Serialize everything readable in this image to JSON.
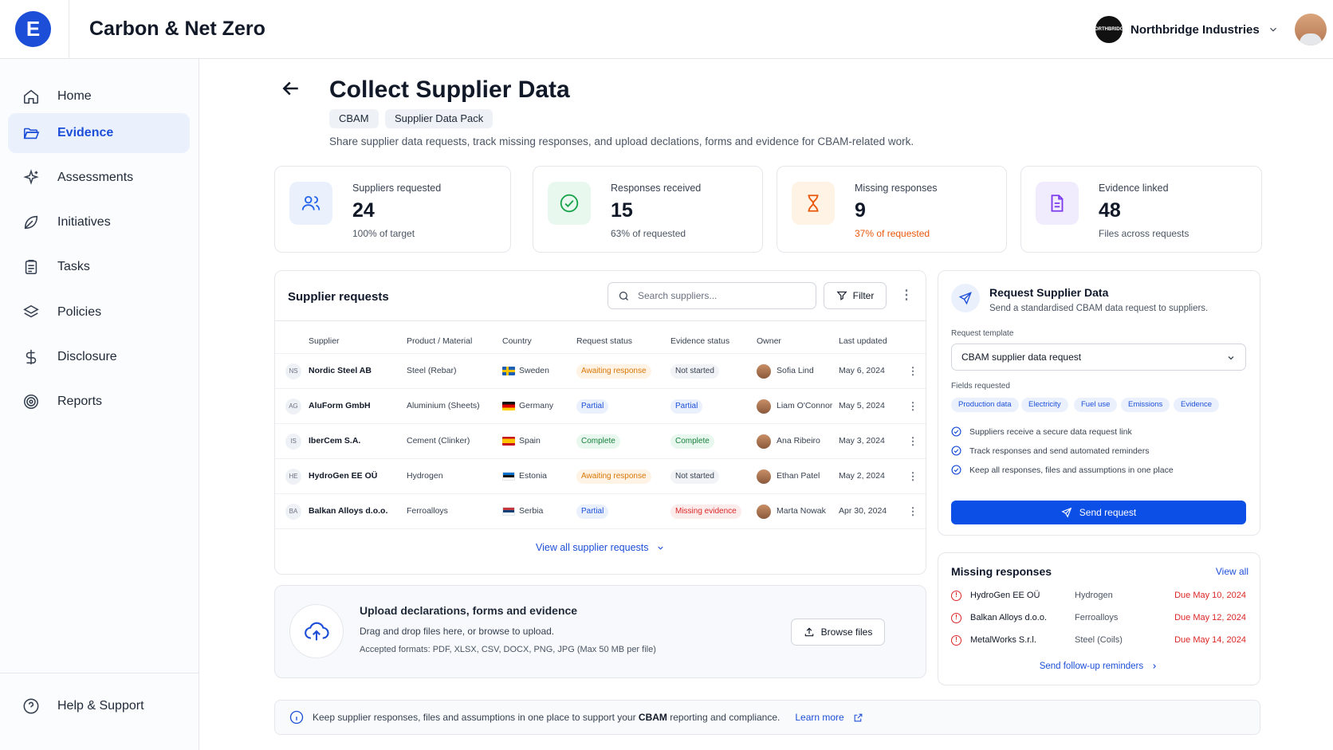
{
  "app": {
    "logo_letter": "E",
    "title": "Carbon & Net Zero",
    "org_name": "Northbridge Industries",
    "org_logo_text": "NORTHBRIDGE"
  },
  "nav": {
    "items": [
      {
        "label": "Home"
      },
      {
        "label": "Evidence"
      },
      {
        "label": "Assessments"
      },
      {
        "label": "Initiatives"
      },
      {
        "label": "Tasks"
      },
      {
        "label": "Policies"
      },
      {
        "label": "Disclosure"
      },
      {
        "label": "Reports"
      }
    ],
    "help": "Help & Support"
  },
  "page": {
    "title": "Collect Supplier Data",
    "chips": [
      "CBAM",
      "Supplier Data Pack"
    ],
    "subtitle": "Share supplier data requests, track missing responses, and upload declations, forms and evidence for CBAM-related work."
  },
  "stats": [
    {
      "label": "Suppliers requested",
      "value": "24",
      "sub": "100% of target",
      "color": "#2563eb"
    },
    {
      "label": "Responses received",
      "value": "15",
      "sub": "63% of requested",
      "color": "#16a34a"
    },
    {
      "label": "Missing responses",
      "value": "9",
      "sub": "37% of requested",
      "color": "#ea580c"
    },
    {
      "label": "Evidence linked",
      "value": "48",
      "sub": "Files across requests",
      "color": "#7c3aed"
    }
  ],
  "requests": {
    "title": "Supplier requests",
    "search_placeholder": "Search suppliers...",
    "filter_label": "Filter",
    "columns": [
      "Supplier",
      "Product / Material",
      "Country",
      "Request status",
      "Evidence status",
      "Owner",
      "Last updated"
    ],
    "rows": [
      {
        "initials": "NS",
        "supplier": "Nordic Steel AB",
        "product": "Steel (Rebar)",
        "country": "Sweden",
        "request_status": "Awaiting response",
        "evidence_status": "Not started",
        "owner": "Sofia Lind",
        "updated": "May 6, 2024"
      },
      {
        "initials": "AG",
        "supplier": "AluForm GmbH",
        "product": "Aluminium (Sheets)",
        "country": "Germany",
        "request_status": "Partial",
        "evidence_status": "Partial",
        "owner": "Liam O'Connor",
        "updated": "May 5, 2024"
      },
      {
        "initials": "IS",
        "supplier": "IberCem S.A.",
        "product": "Cement (Clinker)",
        "country": "Spain",
        "request_status": "Complete",
        "evidence_status": "Complete",
        "owner": "Ana Ribeiro",
        "updated": "May 3, 2024"
      },
      {
        "initials": "HE",
        "supplier": "HydroGen EE OÜ",
        "product": "Hydrogen",
        "country": "Estonia",
        "request_status": "Awaiting response",
        "evidence_status": "Not started",
        "owner": "Ethan Patel",
        "updated": "May 2, 2024"
      },
      {
        "initials": "BA",
        "supplier": "Balkan Alloys d.o.o.",
        "product": "Ferroalloys",
        "country": "Serbia",
        "request_status": "Partial",
        "evidence_status": "Missing evidence",
        "owner": "Marta Nowak",
        "updated": "Apr 30, 2024"
      }
    ],
    "view_all": "View all supplier requests"
  },
  "upload": {
    "title": "Upload declarations, forms and evidence",
    "subtitle": "Drag and drop files here, or browse to upload.",
    "formats": "Accepted formats: PDF, XLSX, CSV, DOCX, PNG, JPG (Max 50 MB per file)",
    "button": "Browse files"
  },
  "request_panel": {
    "title": "Request Supplier Data",
    "subtitle": "Send a standardised CBAM data request to suppliers.",
    "template_label": "Request template",
    "template_value": "CBAM supplier data request",
    "fields_label": "Fields requested",
    "fields": [
      "Production data",
      "Electricity",
      "Fuel use",
      "Emissions",
      "Evidence"
    ],
    "checks": [
      "Suppliers receive a secure data request link",
      "Track responses and send automated reminders",
      "Keep all responses, files and assumptions in one place"
    ],
    "send_label": "Send request"
  },
  "missing": {
    "title": "Missing responses",
    "view_all": "View all",
    "items": [
      {
        "name": "HydroGen EE OÜ",
        "material": "Hydrogen",
        "due": "Due May 10, 2024"
      },
      {
        "name": "Balkan Alloys d.o.o.",
        "material": "Ferroalloys",
        "due": "Due May 12, 2024"
      },
      {
        "name": "MetalWorks S.r.l.",
        "material": "Steel (Coils)",
        "due": "Due May 14, 2024"
      }
    ],
    "follow_up": "Send follow-up reminders"
  },
  "banner": {
    "text_before": "Keep supplier responses, files and assumptions in one place to support your",
    "text_bold": "CBAM",
    "text_after": "reporting and compliance.",
    "link": "Learn more"
  }
}
